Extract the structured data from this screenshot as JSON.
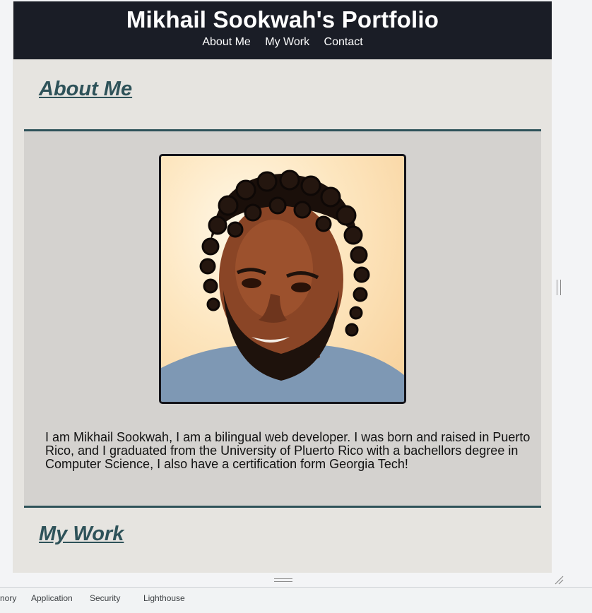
{
  "header": {
    "title": "Mikhail Sookwah's Portfolio",
    "nav": [
      "About Me",
      "My Work",
      "Contact"
    ]
  },
  "about": {
    "heading": "About Me",
    "text": "I am Mikhail Sookwah, I am a bilingual web developer. I was born and raised in Puerto Rico, and I graduated from the University of Pluerto Rico with a bachellors degree in Computer Science, I also have a certification form Georgia Tech!"
  },
  "work": {
    "heading": "My Work"
  },
  "devtools": {
    "tabs": [
      "nory",
      "Application",
      "Security",
      "Lighthouse"
    ]
  },
  "colors": {
    "header_bg": "#1a1d26",
    "accent": "#2e5259",
    "page_bg": "#e6e4e0",
    "card_bg": "#d4d2cf"
  }
}
